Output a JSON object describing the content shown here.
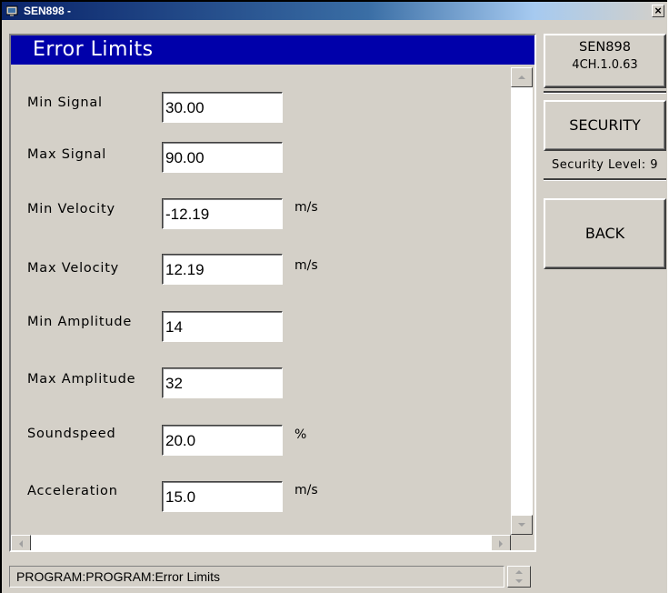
{
  "window": {
    "title": "SEN898 -",
    "close_glyph": "×"
  },
  "panel": {
    "title": "Error Limits",
    "fields": [
      {
        "label": "Min Signal",
        "value": "30.00",
        "unit": ""
      },
      {
        "label": "Max Signal",
        "value": "90.00",
        "unit": ""
      },
      {
        "label": "Min Velocity",
        "value": "-12.19",
        "unit": "m/s"
      },
      {
        "label": "Max Velocity",
        "value": "12.19",
        "unit": "m/s"
      },
      {
        "label": "Min Amplitude",
        "value": "14",
        "unit": ""
      },
      {
        "label": "Max Amplitude",
        "value": "32",
        "unit": ""
      },
      {
        "label": "Soundspeed",
        "value": "20.0",
        "unit": "%"
      },
      {
        "label": "Acceleration",
        "value": "15.0",
        "unit": "m/s"
      }
    ]
  },
  "sidebar": {
    "device_name": "SEN898",
    "version": "4CH.1.0.63",
    "security_label": "SECURITY",
    "security_level_text": "Security Level: 9",
    "back_label": "BACK"
  },
  "status": {
    "path": "PROGRAM:PROGRAM:Error Limits"
  },
  "colors": {
    "panel_header_bg": "#0000aa",
    "title_bar": "#0a246a",
    "window_bg": "#d4d0c8"
  },
  "icons": [
    "app-icon",
    "close-icon",
    "scroll-up-arrow-icon",
    "scroll-down-arrow-icon",
    "scroll-left-arrow-icon",
    "scroll-right-arrow-icon"
  ]
}
